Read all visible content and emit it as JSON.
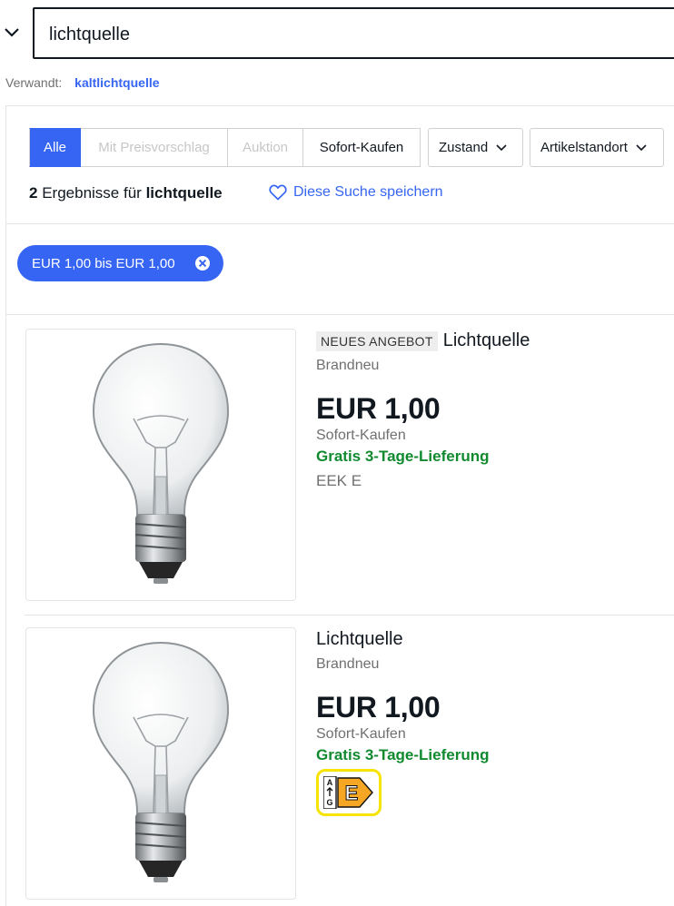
{
  "search": {
    "value": "lichtquelle"
  },
  "related": {
    "label": "Verwandt:",
    "link": "kaltlichtquelle"
  },
  "filters": {
    "segments": [
      "Alle",
      "Mit Preisvorschlag",
      "Auktion",
      "Sofort-Kaufen"
    ],
    "dropdowns": [
      "Zustand",
      "Artikelstandort"
    ]
  },
  "results": {
    "count": "2",
    "text": "Ergebnisse für",
    "query": "lichtquelle",
    "save_label": "Diese Suche speichern"
  },
  "chip": {
    "label": "EUR 1,00 bis EUR 1,00"
  },
  "items": [
    {
      "badge": "NEUES ANGEBOT",
      "title": "Lichtquelle",
      "condition": "Brandneu",
      "price": "EUR 1,00",
      "buy_type": "Sofort-Kaufen",
      "shipping": "Gratis 3-Tage-Lieferung",
      "eek": "EEK E"
    },
    {
      "title": "Lichtquelle",
      "condition": "Brandneu",
      "price": "EUR 1,00",
      "buy_type": "Sofort-Kaufen",
      "shipping": "Gratis 3-Tage-Lieferung",
      "energy_class": "E"
    }
  ],
  "colors": {
    "accent": "#3665f3",
    "shipping_green": "#118a2f",
    "energy_orange": "#f5a623",
    "highlight_yellow": "#f7e300"
  }
}
